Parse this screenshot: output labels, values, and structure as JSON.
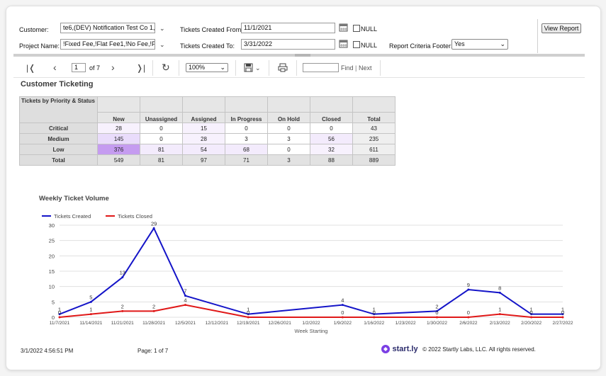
{
  "params": {
    "customer_label": "Customer:",
    "customer_value": "te6,(DEV) Notification Test Co 1,(G",
    "project_label": "Project Name:",
    "project_value": "!Fixed Fee,!Flat Fee1,!No Fee,!Pric",
    "from_label": "Tickets Created From:",
    "from_value": "11/1/2021",
    "to_label": "Tickets Created To:",
    "to_value": "3/31/2022",
    "null_label": "NULL",
    "footer_label": "Report Criteria Footer:",
    "footer_value": "Yes",
    "view_report": "View Report"
  },
  "toolbar": {
    "page_value": "1",
    "page_of": "of 7",
    "zoom": "100%",
    "find_placeholder": "",
    "find": "Find",
    "separator": "|",
    "next": "Next"
  },
  "report_title": "Customer Ticketing",
  "matrix": {
    "corner": "Tickets by Priority & Status",
    "columns": [
      "New",
      "Unassigned",
      "Assigned",
      "In Progress",
      "On Hold",
      "Closed",
      "Total"
    ],
    "rows": [
      {
        "label": "Critical",
        "values": [
          "28",
          "0",
          "15",
          "0",
          "0",
          "0",
          "43"
        ]
      },
      {
        "label": "Medium",
        "values": [
          "145",
          "0",
          "28",
          "3",
          "3",
          "56",
          "235"
        ]
      },
      {
        "label": "Low",
        "values": [
          "376",
          "81",
          "54",
          "68",
          "0",
          "32",
          "611"
        ]
      },
      {
        "label": "Total",
        "values": [
          "549",
          "81",
          "97",
          "71",
          "3",
          "88",
          "889"
        ]
      }
    ],
    "highlight_colors": {
      "strong": "#c59cf0",
      "medium": "#e9dcfb",
      "light": "#f7f1fd"
    }
  },
  "chart_data": {
    "type": "line",
    "title": "Weekly Ticket Volume",
    "xlabel": "Week Starting",
    "ylabel": "",
    "ylim": [
      0,
      30
    ],
    "yticks": [
      0,
      5,
      10,
      15,
      20,
      25,
      30
    ],
    "grid": true,
    "legend": "top-left",
    "x": [
      "11/7/2021",
      "11/14/2021",
      "11/21/2021",
      "11/28/2021",
      "12/5/2021",
      "12/12/2021",
      "12/19/2021",
      "12/26/2021",
      "1/2/2022",
      "1/9/2022",
      "1/16/2022",
      "1/23/2022",
      "1/30/2022",
      "2/6/2022",
      "2/13/2022",
      "2/20/2022",
      "2/27/2022"
    ],
    "series": [
      {
        "name": "Tickets Created",
        "color": "#1414c8",
        "points": [
          [
            0,
            1
          ],
          [
            1,
            5
          ],
          [
            2,
            13
          ],
          [
            3,
            29
          ],
          [
            4,
            7
          ],
          [
            6,
            1
          ],
          [
            9,
            4
          ],
          [
            10,
            1
          ],
          [
            12,
            2
          ],
          [
            13,
            9
          ],
          [
            14,
            8
          ],
          [
            15,
            1
          ],
          [
            16,
            1
          ]
        ]
      },
      {
        "name": "Tickets Closed",
        "color": "#e01818",
        "points": [
          [
            0,
            0
          ],
          [
            1,
            1
          ],
          [
            2,
            2
          ],
          [
            3,
            2
          ],
          [
            4,
            4
          ],
          [
            6,
            0
          ],
          [
            9,
            0
          ],
          [
            10,
            0
          ],
          [
            12,
            0
          ],
          [
            13,
            0
          ],
          [
            14,
            1
          ],
          [
            15,
            0
          ],
          [
            16,
            0
          ]
        ]
      }
    ]
  },
  "footer": {
    "timestamp": "3/1/2022 4:56:51 PM",
    "page": "Page: 1 of 7",
    "logo": "start.ly",
    "copyright": "© 2022 Startly Labs, LLC. All rights reserved."
  }
}
